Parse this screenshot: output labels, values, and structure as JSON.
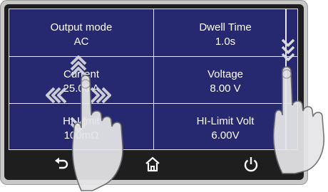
{
  "cells": [
    {
      "label": "Output mode",
      "value": "AC"
    },
    {
      "label": "Dwell  Time",
      "value": "1.0s"
    },
    {
      "label": "Current",
      "value": "25.00 A"
    },
    {
      "label": "Voltage",
      "value": "8.00 V"
    },
    {
      "label": "HI-Limit",
      "value": "100mΩ"
    },
    {
      "label": "HI-Limit Volt",
      "value": "6.00V"
    }
  ],
  "navbar": {
    "icons": [
      "back-arrow-icon",
      "home-icon",
      "power-icon"
    ]
  },
  "colors": {
    "screen_bg": "#262870",
    "grid_line": "#e8e8f4",
    "bezel": "#1e1e1e",
    "device_frame": "#c8c8c8"
  }
}
